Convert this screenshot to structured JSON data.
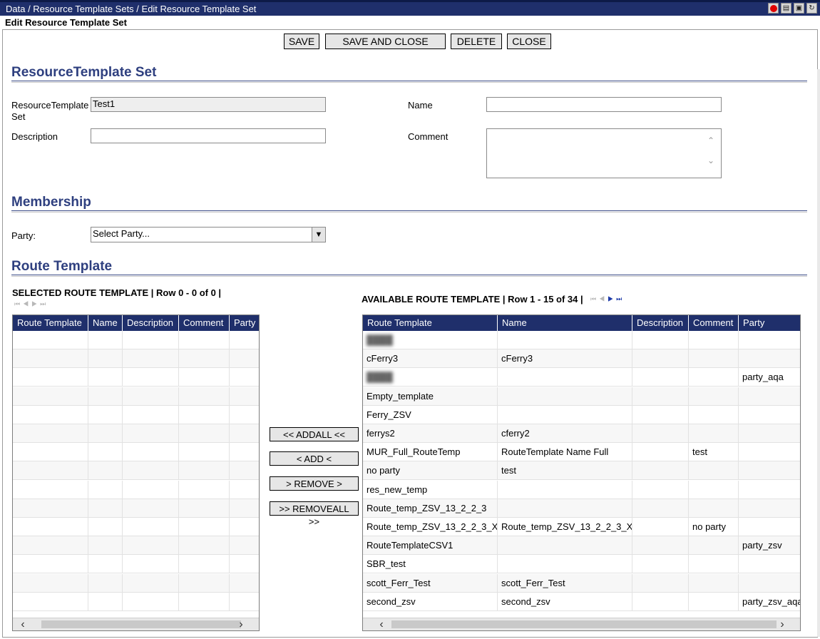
{
  "window": {
    "breadcrumb": "Data / Resource Template Sets / Edit Resource Template Set",
    "subtitle": "Edit Resource Template Set",
    "icons": [
      "record-icon",
      "save-icon",
      "lock-icon",
      "refresh-icon"
    ]
  },
  "toolbar": {
    "save": "SAVE",
    "save_close": "SAVE AND CLOSE",
    "delete": "DELETE",
    "close": "CLOSE"
  },
  "resource_section": {
    "title": "ResourceTemplate Set",
    "set_label_1": "ResourceTemplate",
    "set_label_2": "Set",
    "set_value": "Test1",
    "name_label": "Name",
    "name_value": "",
    "description_label": "Description",
    "description_value": "",
    "comment_label": "Comment",
    "comment_value": ""
  },
  "membership": {
    "title": "Membership",
    "party_label": "Party:",
    "party_value": "Select Party..."
  },
  "route_section": {
    "title": "Route Template"
  },
  "selected_grid": {
    "title": "SELECTED ROUTE TEMPLATE | Row 0 - 0 of 0 |",
    "columns": [
      "Route Template",
      "Name",
      "Description",
      "Comment",
      "Party"
    ]
  },
  "transfer_buttons": {
    "add_all": "<< ADDALL <<",
    "add": "< ADD <",
    "remove": "> REMOVE >",
    "remove_all": ">> REMOVEALL >>"
  },
  "available_grid": {
    "title": "AVAILABLE ROUTE TEMPLATE | Row 1 - 15 of 34 |",
    "columns": [
      "Route Template",
      "Name",
      "Description",
      "Comment",
      "Party"
    ],
    "rows": [
      {
        "route": "",
        "name": "",
        "description": "",
        "comment": "",
        "party": "",
        "redacted": true
      },
      {
        "route": "cFerry3",
        "name": "cFerry3",
        "description": "",
        "comment": "",
        "party": ""
      },
      {
        "route": "",
        "name": "",
        "description": "",
        "comment": "",
        "party": "party_aqa",
        "redacted": true
      },
      {
        "route": "Empty_template",
        "name": "",
        "description": "",
        "comment": "",
        "party": ""
      },
      {
        "route": "Ferry_ZSV",
        "name": "",
        "description": "",
        "comment": "",
        "party": ""
      },
      {
        "route": "ferrys2",
        "name": "cferry2",
        "description": "",
        "comment": "",
        "party": ""
      },
      {
        "route": "MUR_Full_RouteTemp",
        "name": "RouteTemplate Name Full",
        "description": "",
        "comment": "test",
        "party": ""
      },
      {
        "route": "no party",
        "name": "test",
        "description": "",
        "comment": "",
        "party": ""
      },
      {
        "route": "res_new_temp",
        "name": "",
        "description": "",
        "comment": "",
        "party": ""
      },
      {
        "route": "Route_temp_ZSV_13_2_2_3",
        "name": "",
        "description": "",
        "comment": "",
        "party": ""
      },
      {
        "route": "Route_temp_ZSV_13_2_2_3_X",
        "name": "Route_temp_ZSV_13_2_2_3_X",
        "description": "",
        "comment": "no party",
        "party": ""
      },
      {
        "route": "RouteTemplateCSV1",
        "name": "",
        "description": "",
        "comment": "",
        "party": "party_zsv"
      },
      {
        "route": "SBR_test",
        "name": "",
        "description": "",
        "comment": "",
        "party": ""
      },
      {
        "route": "scott_Ferr_Test",
        "name": "scott_Ferr_Test",
        "description": "",
        "comment": "",
        "party": ""
      },
      {
        "route": "second_zsv",
        "name": "second_zsv",
        "description": "",
        "comment": "",
        "party": "party_zsv_aqa"
      }
    ]
  }
}
